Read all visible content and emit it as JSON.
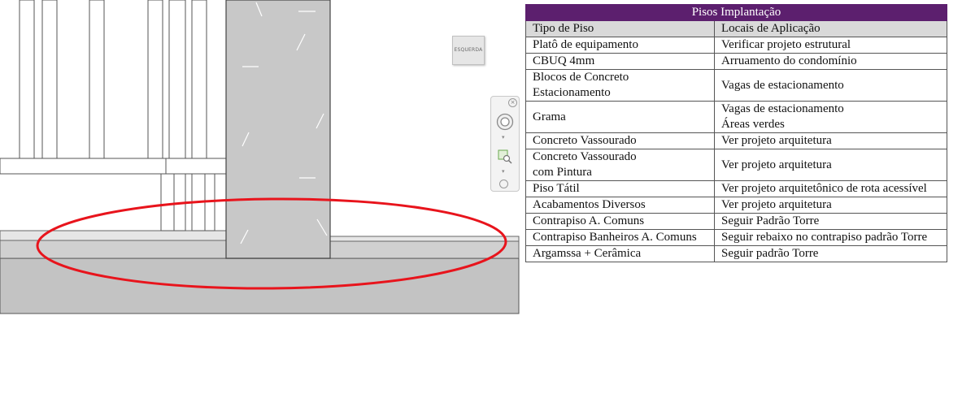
{
  "viewcube": {
    "face_label": "ESQUERDA"
  },
  "navbar": {
    "close_glyph": "×",
    "wheel_icon": "steering-wheel-icon",
    "zoom_icon": "zoom-region-icon",
    "arrow_glyph": "▾"
  },
  "colors": {
    "title_bar": "#5c1f6e",
    "header_bg": "#d9d9d9",
    "markup_ellipse": "#e8141c",
    "concrete_fill": "#c8c8c8"
  },
  "table": {
    "title": "Pisos Implantação",
    "headers": [
      "Tipo de Piso",
      "Locais de Aplicação"
    ],
    "rows": [
      {
        "tipo": [
          "Platô de equipamento"
        ],
        "locais": [
          "Verificar projeto estrutural"
        ]
      },
      {
        "tipo": [
          "CBUQ 4mm"
        ],
        "locais": [
          "Arruamento do condomínio"
        ]
      },
      {
        "tipo": [
          "Blocos de Concreto",
          "Estacionamento"
        ],
        "locais": [
          "Vagas de estacionamento"
        ]
      },
      {
        "tipo": [
          "Grama"
        ],
        "locais": [
          "Vagas de estacionamento",
          "Áreas verdes"
        ]
      },
      {
        "tipo": [
          "Concreto Vassourado"
        ],
        "locais": [
          "Ver projeto arquitetura"
        ]
      },
      {
        "tipo": [
          "Concreto Vassourado",
          "com Pintura"
        ],
        "locais": [
          "Ver projeto arquitetura"
        ]
      },
      {
        "tipo": [
          "Piso Tátil"
        ],
        "locais": [
          "Ver projeto arquitetônico de rota acessível"
        ]
      },
      {
        "tipo": [
          "Acabamentos Diversos"
        ],
        "locais": [
          "Ver projeto arquitetura"
        ]
      },
      {
        "tipo": [
          "Contrapiso A. Comuns"
        ],
        "locais": [
          "Seguir Padrão Torre"
        ]
      },
      {
        "tipo": [
          "Contrapiso Banheiros A. Comuns"
        ],
        "locais": [
          "Seguir rebaixo no contrapiso padrão Torre"
        ]
      },
      {
        "tipo": [
          "Argamssa + Cerâmica"
        ],
        "locais": [
          "Seguir padrão Torre"
        ]
      }
    ]
  }
}
